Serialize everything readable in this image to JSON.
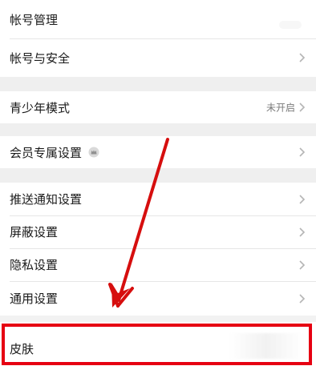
{
  "groups": [
    {
      "items": [
        {
          "label": "帐号管理",
          "has_chevron": false
        },
        {
          "label": "帐号与安全",
          "has_chevron": true
        }
      ]
    },
    {
      "items": [
        {
          "label": "青少年模式",
          "status": "未开启",
          "has_chevron": true
        }
      ]
    },
    {
      "items": [
        {
          "label": "会员专属设置",
          "has_badge": true,
          "badge_icon": "vip-crown-icon",
          "has_chevron": true
        }
      ]
    },
    {
      "items": [
        {
          "label": "推送通知设置",
          "has_chevron": true
        },
        {
          "label": "屏蔽设置",
          "has_chevron": true
        },
        {
          "label": "隐私设置",
          "has_chevron": true
        },
        {
          "label": "通用设置",
          "has_chevron": true
        }
      ]
    }
  ],
  "highlight": {
    "label": "皮肤",
    "frame_color": "#e60012"
  },
  "annotation": {
    "arrow_color": "#d60e0e"
  }
}
